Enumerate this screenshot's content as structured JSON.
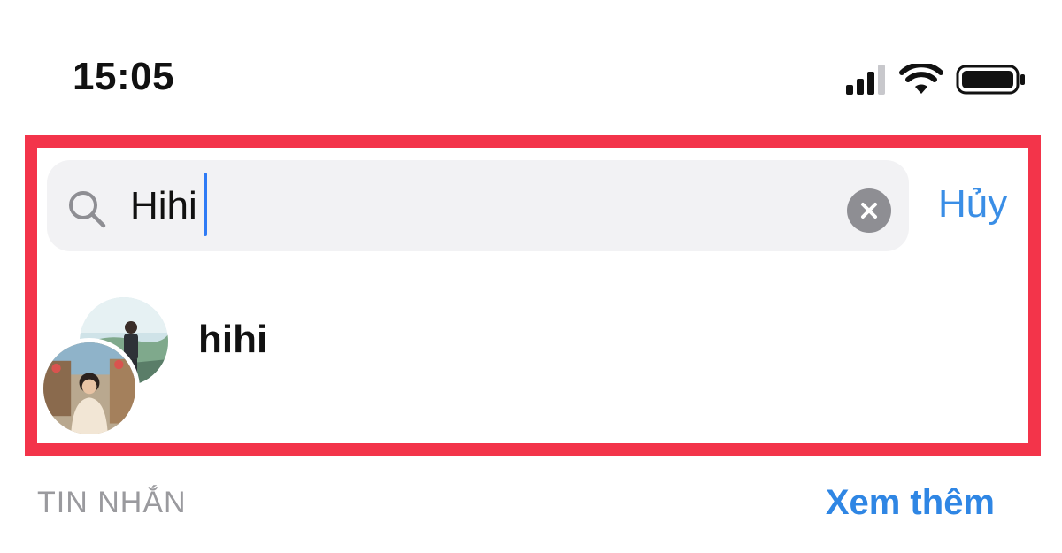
{
  "status_bar": {
    "time": "15:05",
    "icons": [
      "signal-icon",
      "wifi-icon",
      "battery-icon"
    ]
  },
  "search": {
    "value": "Hihi",
    "icon": "search-icon",
    "clear_icon": "clear-icon",
    "cancel_label": "Hủy"
  },
  "results": [
    {
      "name": "hihi",
      "avatar": "group-avatar"
    }
  ],
  "section": {
    "title": "TIN NHẮN",
    "see_more_label": "Xem thêm"
  },
  "colors": {
    "highlight": "#f3344a",
    "accent": "#2f86e4",
    "cursor": "#2f7bf5"
  }
}
